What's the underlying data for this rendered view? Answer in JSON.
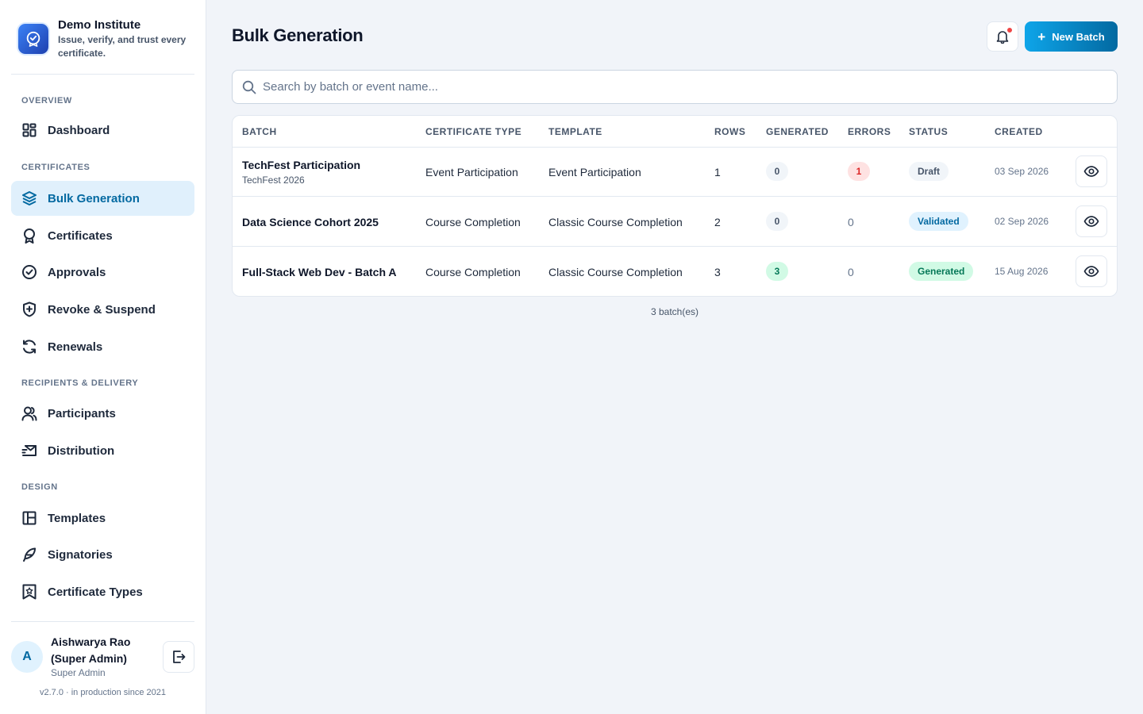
{
  "brand": {
    "name": "Demo Institute",
    "tagline": "Issue, verify, and trust every certificate."
  },
  "sidebar": {
    "sections": [
      "OVERVIEW",
      "CERTIFICATES",
      "RECIPIENTS & DELIVERY",
      "DESIGN"
    ],
    "items": [
      {
        "label": "Dashboard",
        "icon": "dashboard-grid-icon"
      },
      {
        "label": "Bulk Generation",
        "icon": "layers-icon",
        "active": true
      },
      {
        "label": "Certificates",
        "icon": "award-ribbon-icon"
      },
      {
        "label": "Approvals",
        "icon": "check-circle-icon"
      },
      {
        "label": "Revoke & Suspend",
        "icon": "shield-plus-icon"
      },
      {
        "label": "Renewals",
        "icon": "refresh-icon"
      },
      {
        "label": "Participants",
        "icon": "users-icon"
      },
      {
        "label": "Distribution",
        "icon": "mail-send-icon"
      },
      {
        "label": "Templates",
        "icon": "template-layout-icon"
      },
      {
        "label": "Signatories",
        "icon": "feather-pen-icon"
      },
      {
        "label": "Certificate Types",
        "icon": "bookmark-star-icon"
      }
    ]
  },
  "user": {
    "initial": "A",
    "name": "Aishwarya Rao (Super Admin)",
    "role": "Super Admin"
  },
  "version": "v2.7.0 · in production since 2021",
  "header": {
    "title": "Bulk Generation",
    "new_batch_label": "New Batch"
  },
  "search": {
    "placeholder": "Search by batch or event name...",
    "value": ""
  },
  "table": {
    "columns": [
      "BATCH",
      "CERTIFICATE TYPE",
      "TEMPLATE",
      "ROWS",
      "GENERATED",
      "ERRORS",
      "STATUS",
      "CREATED"
    ],
    "rows": [
      {
        "batch": "TechFest Participation",
        "event": "TechFest 2026",
        "type": "Event Participation",
        "template": "Event Participation",
        "rows": "1",
        "generated": "0",
        "errors": "1",
        "status": "Draft",
        "created": "03 Sep 2026"
      },
      {
        "batch": "Data Science Cohort 2025",
        "event": "",
        "type": "Course Completion",
        "template": "Classic Course Completion",
        "rows": "2",
        "generated": "0",
        "errors": "0",
        "status": "Validated",
        "created": "02 Sep 2026"
      },
      {
        "batch": "Full-Stack Web Dev - Batch A",
        "event": "",
        "type": "Course Completion",
        "template": "Classic Course Completion",
        "rows": "3",
        "generated": "3",
        "errors": "0",
        "status": "Generated",
        "created": "15 Aug 2026"
      }
    ],
    "footer": "3 batch(es)"
  },
  "colors": {
    "accent": "#0284c7",
    "active_bg": "#e0f0fc",
    "status_draft_bg": "#f1f5f9",
    "status_validated_bg": "#e0f2fe",
    "status_generated_bg": "#d1fae5",
    "error_bg": "#fee2e2"
  }
}
